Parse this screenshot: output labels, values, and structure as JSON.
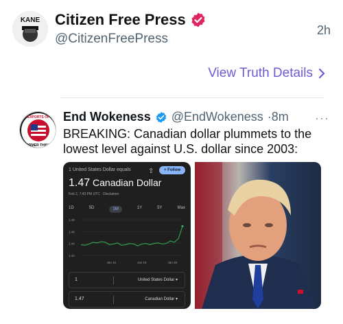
{
  "post": {
    "name": "Citizen Free Press",
    "handle": "@CitizenFreePress",
    "time": "2h",
    "avatar_text": "KANE",
    "view_link": "View Truth Details"
  },
  "quote": {
    "name": "End Wokeness",
    "handle": "@EndWokeness",
    "time": "·8m",
    "text": "BREAKING: Canadian dollar plummets to the lowest level against U.S. dollar since 2003:",
    "avatar_text_top": "EXPORTS OF",
    "avatar_text_bottom": "FORMER THINGS"
  },
  "fx": {
    "top": "1 United States Dollar equals",
    "value": "1.47",
    "currency": "Canadian Dollar",
    "date": "Feb 2, 7:43 PM UTC · Disclaimer",
    "follow": "+ Follow",
    "ranges": [
      "1D",
      "5D",
      "1M",
      "1Y",
      "5Y",
      "Max"
    ],
    "active_range": "1M",
    "field1_num": "1",
    "field1_cur": "United States Dollar ▾",
    "field2_num": "1.47",
    "field2_cur": "Canadian Dollar ▾"
  },
  "chart_data": {
    "type": "line",
    "x": [
      "Jan 10",
      "Jan 19",
      "Jan 28"
    ],
    "y_ticks": [
      "1.48",
      "1.46",
      "1.44",
      "1.42"
    ],
    "ylim": [
      1.42,
      1.48
    ],
    "series": [
      {
        "values": [
          1.438,
          1.437,
          1.439,
          1.442,
          1.441,
          1.443,
          1.442,
          1.438,
          1.439,
          1.441,
          1.437,
          1.438,
          1.44,
          1.439,
          1.436,
          1.439,
          1.44,
          1.438,
          1.44,
          1.441,
          1.439,
          1.44,
          1.444,
          1.442,
          1.448,
          1.469
        ]
      }
    ],
    "line_color": "#34a853"
  },
  "colors": {
    "brand_purple": "#6b5bd6",
    "verify_pink": "#e0245e",
    "verify_blue": "#1d9bf0"
  }
}
